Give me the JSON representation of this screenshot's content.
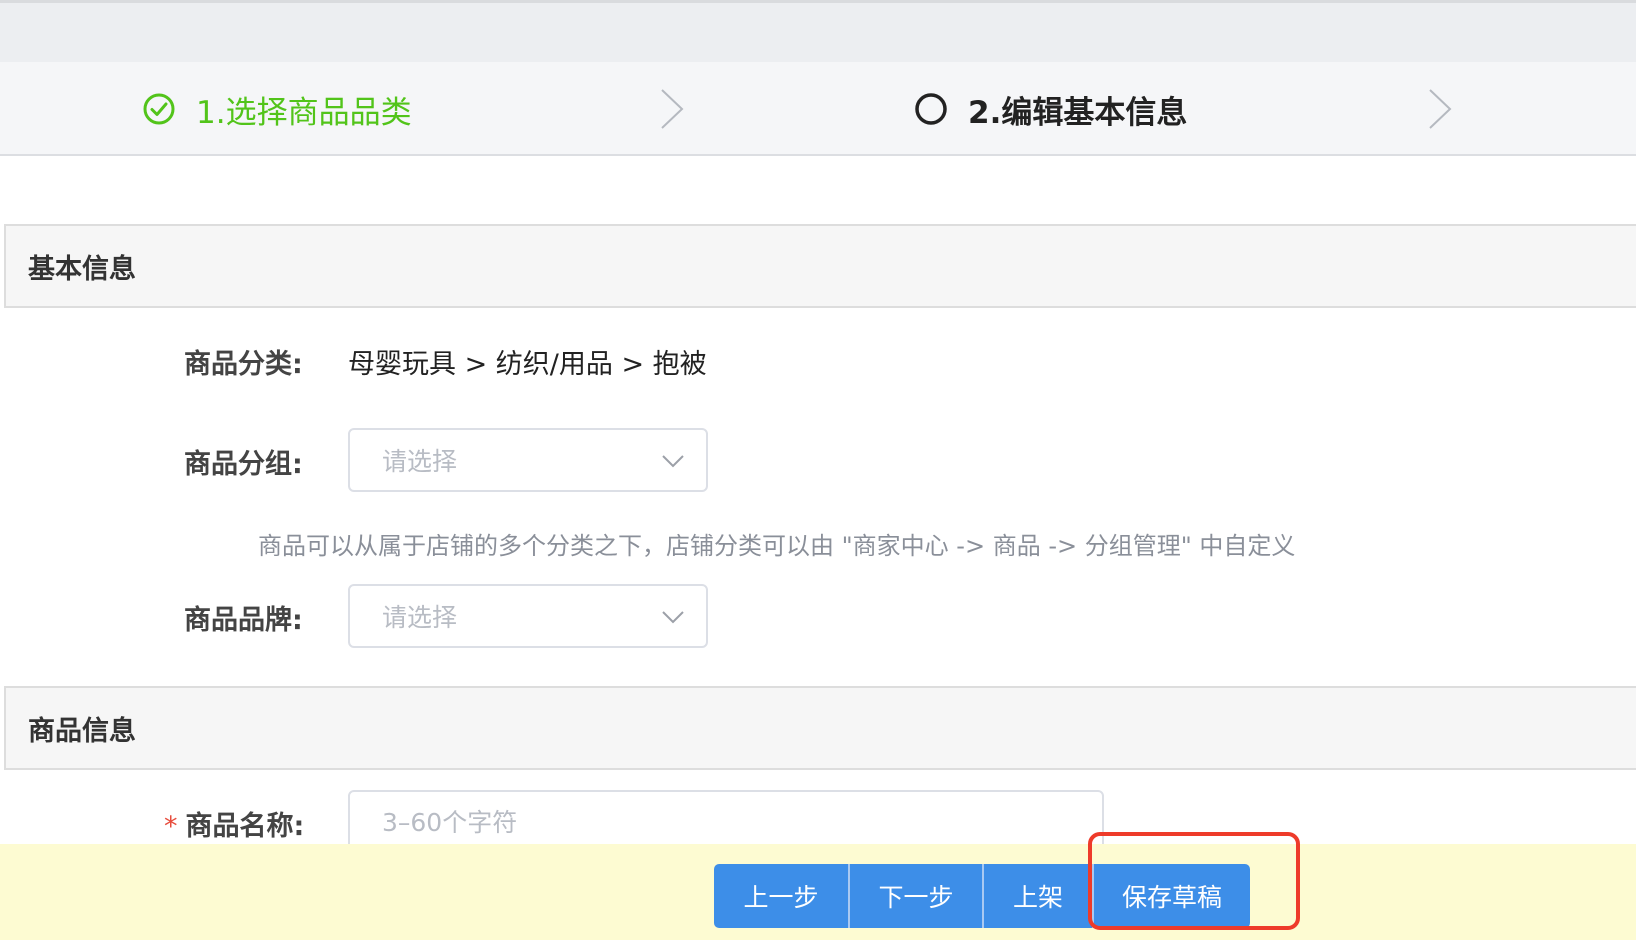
{
  "steps": [
    {
      "label": "1.选择商品品类",
      "status": "done",
      "icon": "check-circle-icon",
      "color": "#52c41a"
    },
    {
      "label": "2.编辑基本信息",
      "status": "current",
      "icon": "circle-icon",
      "color": "#222222"
    }
  ],
  "sections": {
    "basic_info": {
      "title": "基本信息",
      "category_label": "商品分类:",
      "category_value": "母婴玩具 > 纺织/用品 > 抱被",
      "group_label": "商品分组:",
      "group_placeholder": "请选择",
      "group_hint": "商品可以从属于店铺的多个分类之下，店铺分类可以由 \"商家中心 -> 商品 -> 分组管理\" 中自定义",
      "brand_label": "商品品牌:",
      "brand_placeholder": "请选择"
    },
    "product_info": {
      "title": "商品信息",
      "required_mark": "*",
      "name_label": "商品名称:",
      "name_placeholder": "3–60个字符"
    }
  },
  "footer": {
    "prev_label": "上一步",
    "next_label": "下一步",
    "shelf_label": "上架",
    "draft_label": "保存草稿"
  },
  "colors": {
    "accent_blue": "#3d8ee8",
    "success_green": "#52c41a",
    "highlight_red": "#ee3b2a",
    "footer_bg": "#fdfbd2"
  }
}
